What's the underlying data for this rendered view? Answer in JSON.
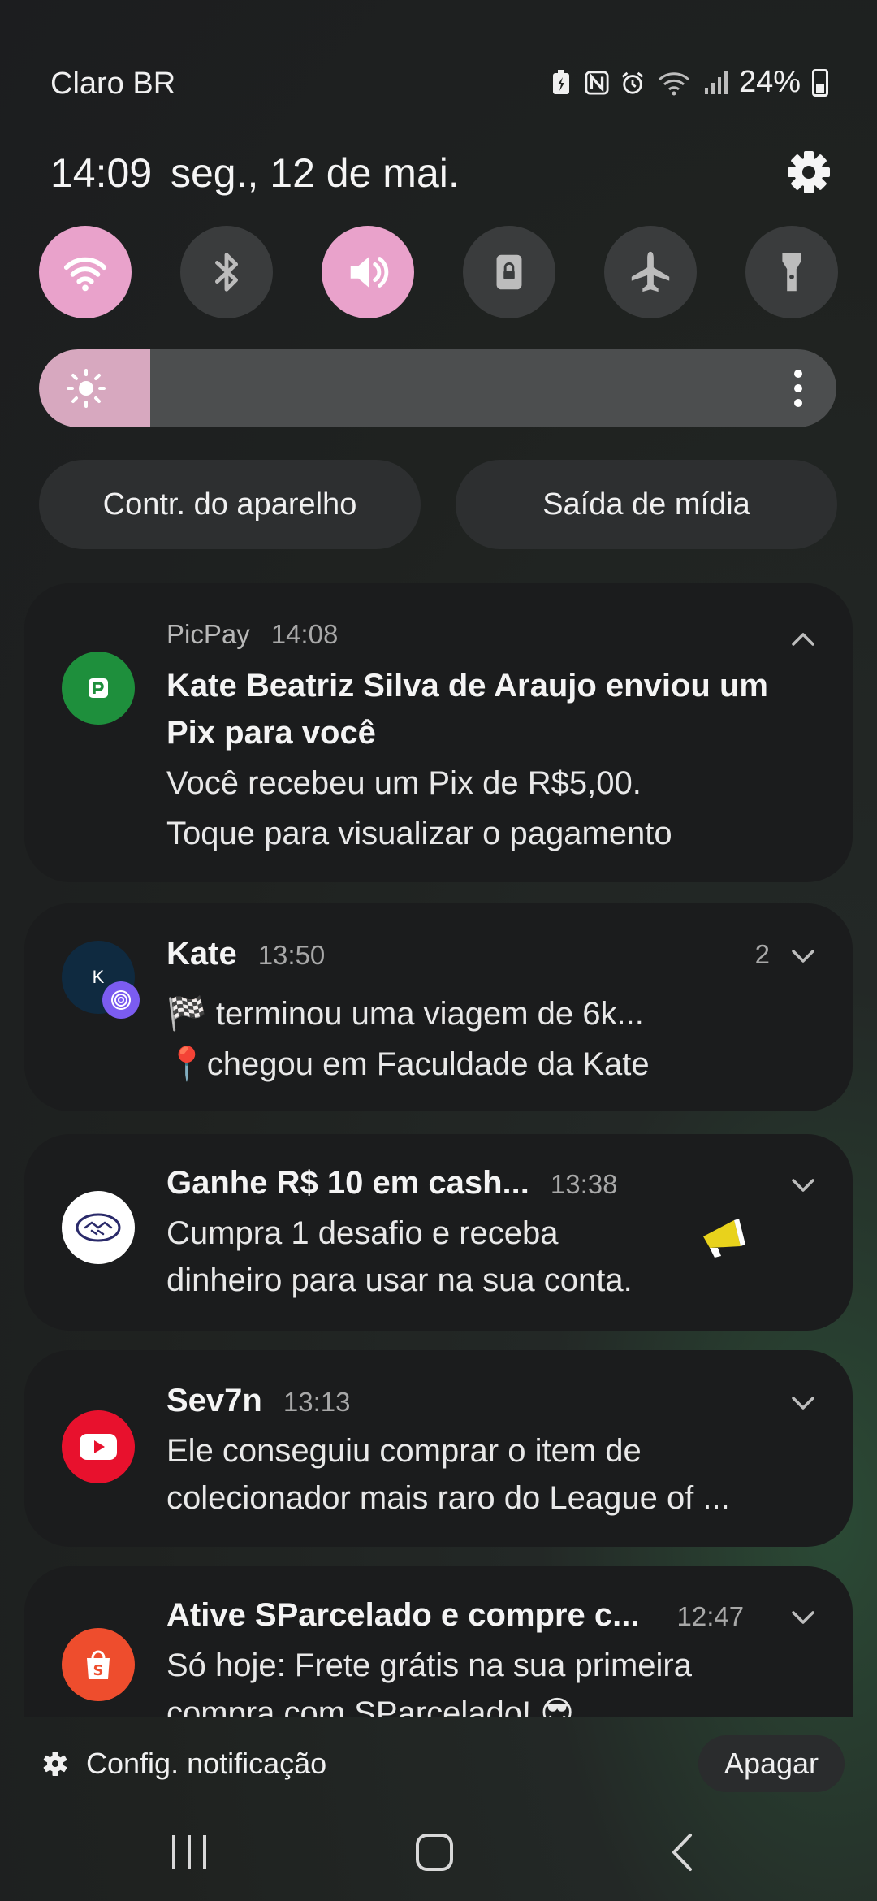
{
  "status_bar": {
    "carrier": "Claro BR",
    "battery_percent": "24%",
    "icons": [
      "battery-saver-icon",
      "nfc-icon",
      "alarm-icon",
      "wifi-icon",
      "signal-icon",
      "battery-icon"
    ]
  },
  "header": {
    "time": "14:09",
    "date": "seg., 12 de mai.",
    "settings_icon": "gear-icon"
  },
  "quick_toggles": [
    {
      "name": "wifi-icon",
      "on": true
    },
    {
      "name": "bluetooth-icon",
      "on": false
    },
    {
      "name": "sound-icon",
      "on": true
    },
    {
      "name": "rotation-lock-icon",
      "on": false
    },
    {
      "name": "airplane-mode-icon",
      "on": false
    },
    {
      "name": "flashlight-icon",
      "on": false
    }
  ],
  "brightness": {
    "level": 0.14
  },
  "buttons": {
    "device_control": "Contr. do aparelho",
    "media_output": "Saída de mídia"
  },
  "notifications": [
    {
      "app": "PicPay",
      "time": "14:08",
      "title": "Kate Beatriz Silva de Araujo enviou um",
      "title2": "Pix para você",
      "line1": "Você recebeu um Pix de R$5,00.",
      "line2": "Toque para visualizar o pagamento",
      "icon_color": "#1e8f3c"
    },
    {
      "title": "Kate",
      "time": "13:50",
      "count": "2",
      "avatar_letter": "K",
      "line1": "🏁 terminou uma viagem de 6k...",
      "line2": "📍chegou em Faculdade da Kate",
      "icon_color": "#0f2a40"
    },
    {
      "title": "Ganhe R$ 10 em cash...",
      "time": "13:38",
      "line1": "Cumpra 1 desafio e receba",
      "line2": "dinheiro para usar na sua conta.",
      "icon_color": "#ffffff"
    },
    {
      "title": "Sev7n",
      "time": "13:13",
      "line1": "Ele conseguiu comprar o item de",
      "line2": "colecionador mais raro do League of ...",
      "icon_color": "#e8112d"
    },
    {
      "title": "Ative SParcelado e compre c...",
      "time": "12:47",
      "line1": "Só hoje: Frete grátis na sua primeira",
      "line2": "compra com SParcelado! 😎",
      "icon_color": "#ee4d2d"
    }
  ],
  "footer": {
    "notification_settings": "Config. notificação",
    "clear": "Apagar"
  },
  "navigation": [
    "recent-apps-icon",
    "home-icon",
    "back-icon"
  ]
}
